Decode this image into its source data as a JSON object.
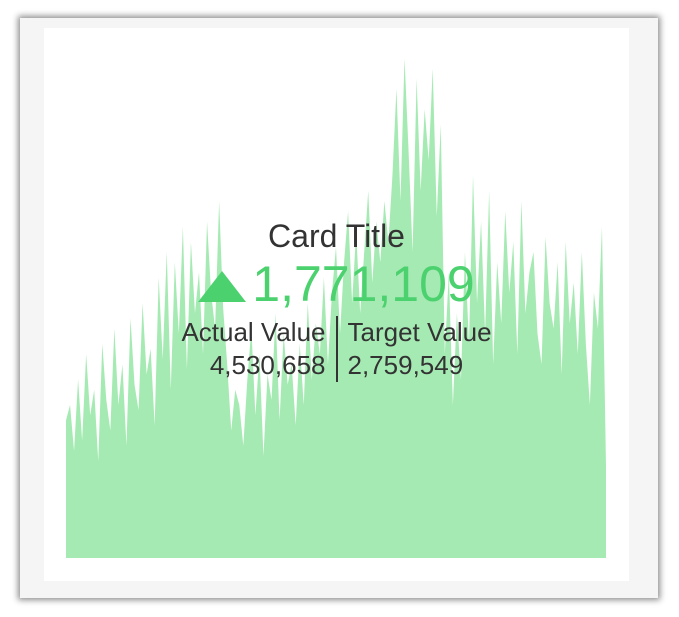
{
  "card": {
    "title": "Card Title",
    "delta": "1,771,109",
    "delta_direction": "up",
    "actual_label": "Actual Value",
    "actual_value": "4,530,658",
    "target_label": "Target Value",
    "target_value": "2,759,549"
  },
  "colors": {
    "positive": "#4cd16f",
    "sparkline_fill": "#a6eab3",
    "text": "#333333"
  },
  "chart_data": {
    "type": "area",
    "title": "",
    "xlabel": "",
    "ylabel": "",
    "grid": false,
    "ylim": [
      0,
      100
    ],
    "values": [
      27,
      30,
      21,
      35,
      23,
      40,
      28,
      33,
      19,
      42,
      31,
      25,
      45,
      30,
      38,
      22,
      47,
      34,
      29,
      50,
      36,
      41,
      26,
      55,
      39,
      60,
      33,
      58,
      44,
      65,
      37,
      62,
      48,
      56,
      40,
      66,
      52,
      45,
      70,
      49,
      38,
      25,
      33,
      30,
      22,
      35,
      45,
      28,
      40,
      20,
      36,
      31,
      48,
      27,
      44,
      34,
      38,
      26,
      42,
      30,
      50,
      35,
      46,
      40,
      55,
      38,
      52,
      61,
      44,
      58,
      68,
      50,
      64,
      48,
      60,
      72,
      54,
      66,
      58,
      70,
      62,
      75,
      92,
      70,
      98,
      80,
      60,
      94,
      72,
      88,
      78,
      96,
      67,
      85,
      40,
      56,
      30,
      48,
      35,
      60,
      42,
      75,
      50,
      66,
      44,
      72,
      38,
      58,
      46,
      68,
      52,
      62,
      40,
      70,
      48,
      56,
      60,
      44,
      38,
      63,
      50,
      45,
      58,
      36,
      62,
      46,
      54,
      40,
      60,
      42,
      30,
      52,
      45,
      65,
      18
    ]
  }
}
